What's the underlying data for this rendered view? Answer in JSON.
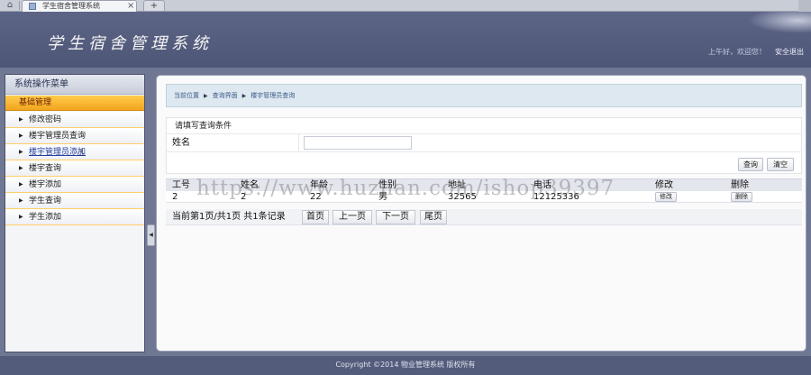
{
  "browser": {
    "home_icon": "home-icon",
    "tab_title": "学生宿舍管理系统",
    "close_glyph": "×",
    "new_tab_glyph": "+"
  },
  "header": {
    "title": "学生宿舍管理系统",
    "greeting": "上午好，欢迎您！",
    "logout": "安全退出"
  },
  "sidebar": {
    "title": "系统操作菜单",
    "group": "基础管理",
    "items": [
      {
        "label": "修改密码"
      },
      {
        "label": "楼宇管理员查询"
      },
      {
        "label": "楼宇管理员添加",
        "active": true
      },
      {
        "label": "楼宇查询"
      },
      {
        "label": "楼宇添加"
      },
      {
        "label": "学生查询"
      },
      {
        "label": "学生添加"
      }
    ],
    "arrow_glyph": "▶",
    "collapse_glyph": "◀"
  },
  "breadcrumb": {
    "items": [
      "当前位置",
      "查询界面",
      "楼宇管理员查询"
    ],
    "sep_glyph": "▶"
  },
  "search_form": {
    "title": "请填写查询条件",
    "name_label": "姓名",
    "name_value": "",
    "query_button": "查询",
    "clear_button": "清空"
  },
  "table": {
    "columns": [
      "工号",
      "姓名",
      "年龄",
      "性别",
      "地址",
      "电话",
      "修改",
      "删除"
    ],
    "rows": [
      {
        "id": "2",
        "name": "2",
        "age": "22",
        "gender": "男",
        "address": "32565",
        "phone": "12125336",
        "edit": "修改",
        "delete": "删除"
      }
    ]
  },
  "pager": {
    "info": "当前第1页/共1页  共1条记录",
    "first": "首页",
    "prev": "上一页",
    "next": "下一页",
    "last": "尾页"
  },
  "watermark": "https://www.huzhan.com/ishop39397",
  "footer": {
    "text": "Copyright ©2014 物业管理系统 版权所有"
  }
}
